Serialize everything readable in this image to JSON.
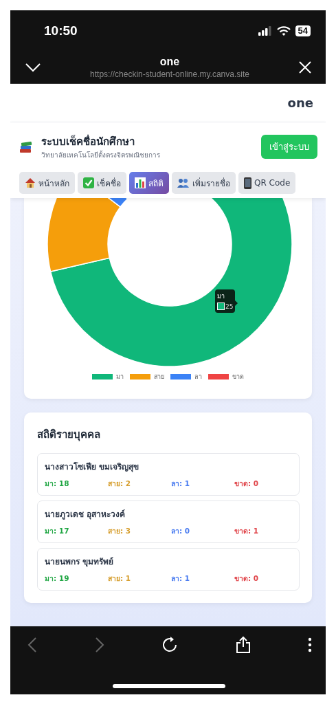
{
  "status_bar": {
    "time": "10:50",
    "battery": "54"
  },
  "browser": {
    "title": "one",
    "url": "https://checkin-student-online.my.canva.site"
  },
  "site_header": {
    "title": "one"
  },
  "app": {
    "title": "ระบบเช็คชื่อนักศึกษา",
    "subtitle": "วิทยาลัยเทคโนโลยีตั้งตรงจิตรพณิชยการ",
    "login_button": "เข้าสู่ระบบ"
  },
  "tabs": [
    {
      "label": "หน้าหลัก",
      "selected": false
    },
    {
      "label": "เช็คชื่อ",
      "selected": false
    },
    {
      "label": "สถิติ",
      "selected": true
    },
    {
      "label": "เพิ่มรายชื่อ",
      "selected": false
    },
    {
      "label": "QR Code",
      "selected": false
    }
  ],
  "chart": {
    "legend": [
      {
        "label": "มา",
        "color": "#10b77a"
      },
      {
        "label": "สาย",
        "color": "#f59e0b"
      },
      {
        "label": "ลา",
        "color": "#3b82f6"
      },
      {
        "label": "ขาด",
        "color": "#ef4444"
      }
    ],
    "tooltip": {
      "title": "มา",
      "value": "25",
      "color": "#10b77a"
    }
  },
  "individual": {
    "title": "สถิติรายบุคคล",
    "students": [
      {
        "name": "นางสาวโซเฟีย ขมเจริญสุข",
        "stats": [
          {
            "label": "มา: 18",
            "color": "#22a745"
          },
          {
            "label": "สาย: 2",
            "color": "#d69e2e"
          },
          {
            "label": "ลา: 1",
            "color": "#4a7cf0"
          },
          {
            "label": "ขาด: 0",
            "color": "#e0454a"
          }
        ]
      },
      {
        "name": "นายภูวเดช อุสาหะวงค์",
        "stats": [
          {
            "label": "มา: 17",
            "color": "#22a745"
          },
          {
            "label": "สาย: 3",
            "color": "#d69e2e"
          },
          {
            "label": "ลา: 0",
            "color": "#4a7cf0"
          },
          {
            "label": "ขาด: 1",
            "color": "#e0454a"
          }
        ]
      },
      {
        "name": "นายนพกร ขุมทรัพย์",
        "stats": [
          {
            "label": "มา: 19",
            "color": "#22a745"
          },
          {
            "label": "สาย: 1",
            "color": "#d69e2e"
          },
          {
            "label": "ลา: 1",
            "color": "#4a7cf0"
          },
          {
            "label": "ขาด: 0",
            "color": "#e0454a"
          }
        ]
      }
    ]
  }
}
